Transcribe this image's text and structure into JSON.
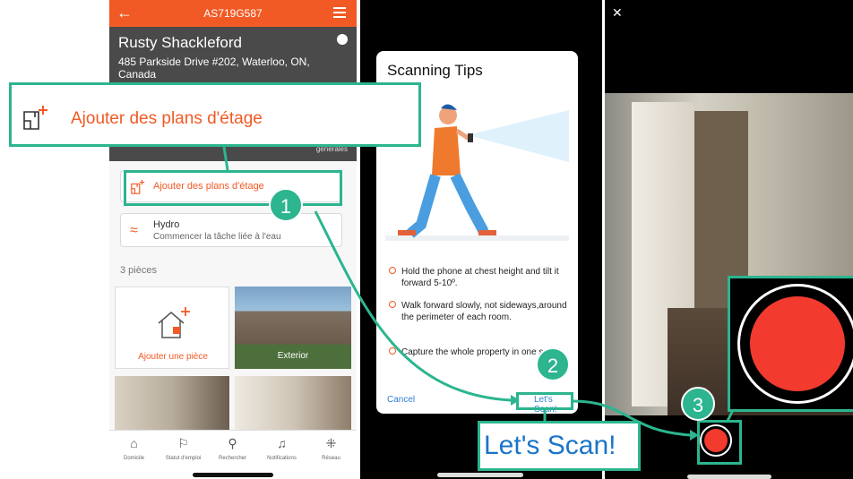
{
  "screen1": {
    "topbar": {
      "code": "AS719G587"
    },
    "header": {
      "name": "Rusty Shackleford",
      "address": "485 Parkside Drive #202, Waterloo, ON, Canada",
      "generales": "générales"
    },
    "floor_plans_label": "Ajouter des plans d'étage",
    "hydro": {
      "title": "Hydro",
      "subtitle": "Commencer la tâche liée à l'eau"
    },
    "rooms_count": "3 pièces",
    "add_room_label": "Ajouter une pièce",
    "exterior_label": "Exterior",
    "nav": [
      {
        "label": "Domicile",
        "icon": "home-icon"
      },
      {
        "label": "Statut d'emploi",
        "icon": "flag-icon"
      },
      {
        "label": "Rechercher",
        "icon": "search-icon"
      },
      {
        "label": "Notifications",
        "icon": "bell-icon"
      },
      {
        "label": "Réseau",
        "icon": "network-icon"
      }
    ]
  },
  "screen2": {
    "title": "Scanning Tips",
    "tips": [
      "Hold the phone at chest height and tilt it forward 5-10º.",
      "Walk forward slowly, not sideways,around the perimeter of each room.",
      "Capture the whole property in one scan."
    ],
    "cancel": "Cancel",
    "lets_scan": "Let's Scan!"
  },
  "callouts": {
    "one": {
      "badge": "1",
      "label": "Ajouter des plans d'étage"
    },
    "two": {
      "badge": "2",
      "label": "Let's Scan!"
    },
    "three": {
      "badge": "3"
    }
  },
  "colors": {
    "accent": "#f15a24",
    "teal": "#2cb58f",
    "link": "#2d7fd3",
    "record": "#f23a2f"
  }
}
